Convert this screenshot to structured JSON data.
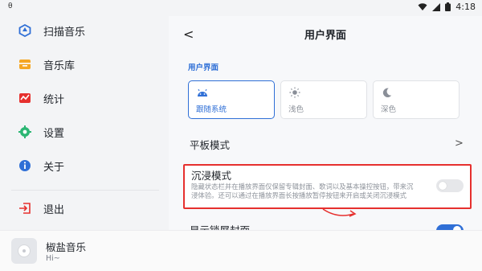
{
  "status_bar": {
    "left_glyph": "θ",
    "time": "4:18",
    "icons": [
      "wifi-icon",
      "cell-signal-icon",
      "battery-icon"
    ]
  },
  "sidebar": {
    "items": [
      {
        "label": "扫描音乐",
        "icon": "scan-music-icon",
        "color": "#2f6fd6"
      },
      {
        "label": "音乐库",
        "icon": "library-icon",
        "color": "#f5a623"
      },
      {
        "label": "统计",
        "icon": "stats-icon",
        "color": "#e6302e"
      },
      {
        "label": "设置",
        "icon": "settings-gear-icon",
        "color": "#2bb673"
      },
      {
        "label": "关于",
        "icon": "info-icon",
        "color": "#2f6fd6"
      },
      {
        "label": "退出",
        "icon": "exit-icon",
        "color": "#e6302e"
      }
    ]
  },
  "player": {
    "title": "椒盐音乐",
    "subtitle": "Hi~"
  },
  "panel": {
    "back_label": "<",
    "heading": "用户界面",
    "section_label": "用户界面",
    "theme_options": [
      {
        "label": "跟随系统",
        "icon": "android-icon",
        "selected": true
      },
      {
        "label": "浅色",
        "icon": "sun-icon",
        "selected": false
      },
      {
        "label": "深色",
        "icon": "moon-icon",
        "selected": false
      }
    ],
    "tablet_mode": {
      "label": "平板模式",
      "chevron": ">"
    },
    "immersive": {
      "title": "沉浸模式",
      "description": "隐藏状态栏并在播放界面仅保留专辑封面、歌词以及基本操控按钮，带来沉浸体验。还可以通过在播放界面长按播放暂停按钮来开启或关闭沉浸模式",
      "enabled": false
    },
    "lockscreen_cover": {
      "label": "显示锁屏封面",
      "enabled": true
    }
  },
  "colors": {
    "accent": "#2f6fd6",
    "annotation_red": "#e6302e"
  }
}
